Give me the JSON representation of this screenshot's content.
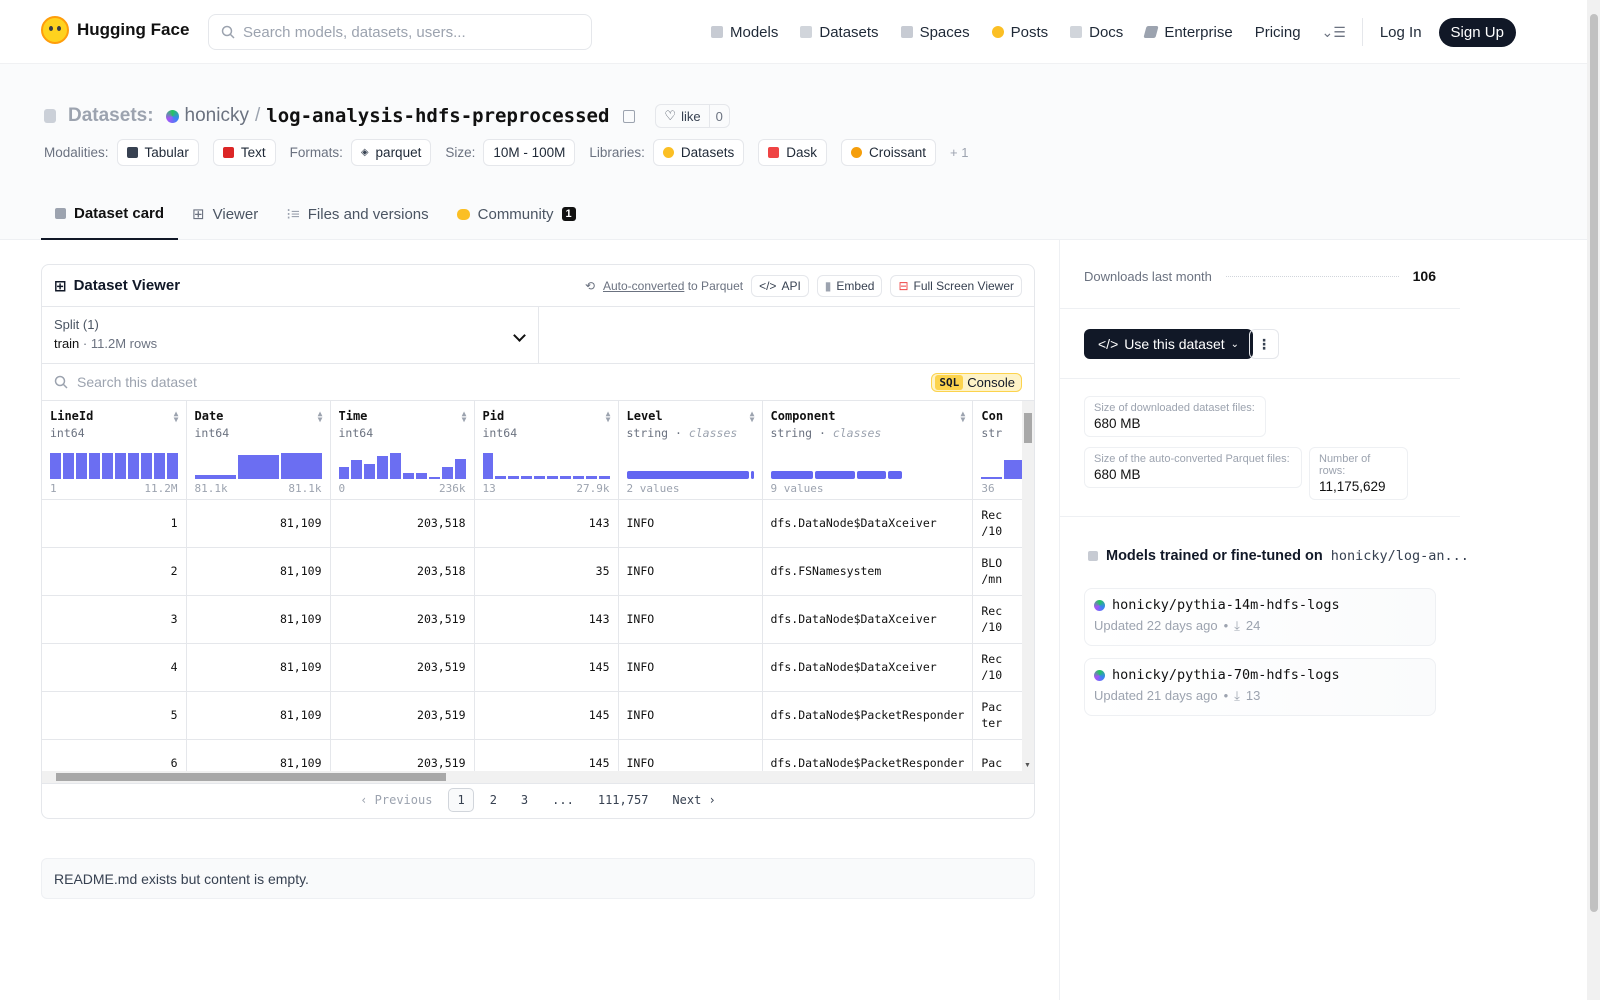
{
  "nav": {
    "brand": "Hugging Face",
    "search_placeholder": "Search models, datasets, users...",
    "links": [
      "Models",
      "Datasets",
      "Spaces",
      "Posts",
      "Docs",
      "Enterprise",
      "Pricing"
    ],
    "login": "Log In",
    "signup": "Sign Up"
  },
  "header": {
    "prefix": "Datasets:",
    "org": "honicky",
    "name": "log-analysis-hdfs-preprocessed",
    "like_label": "like",
    "like_count": "0",
    "modalities_label": "Modalities:",
    "modalities": [
      "Tabular",
      "Text"
    ],
    "formats_label": "Formats:",
    "format": "parquet",
    "size_label": "Size:",
    "size": "10M - 100M",
    "libraries_label": "Libraries:",
    "libraries": [
      "Datasets",
      "Dask",
      "Croissant"
    ],
    "more_libraries": "+ 1",
    "tabs": [
      "Dataset card",
      "Viewer",
      "Files and versions",
      "Community"
    ],
    "community_count": "1"
  },
  "viewer": {
    "title": "Dataset Viewer",
    "auto_converted": "Auto-converted",
    "to_parquet": "to Parquet",
    "api": "API",
    "embed": "Embed",
    "full_screen": "Full Screen Viewer",
    "split_label": "Split (1)",
    "split_name": "train",
    "split_rows": "11.2M rows",
    "search_placeholder": "Search this dataset",
    "sql": "SQL",
    "console": "Console",
    "columns": [
      {
        "name": "LineId",
        "type": "int64",
        "min": "1",
        "max": "11.2M"
      },
      {
        "name": "Date",
        "type": "int64",
        "min": "81.1k",
        "max": "81.1k"
      },
      {
        "name": "Time",
        "type": "int64",
        "min": "0",
        "max": "236k"
      },
      {
        "name": "Pid",
        "type": "int64",
        "min": "13",
        "max": "27.9k"
      },
      {
        "name": "Level",
        "type": "string",
        "sub": "classes",
        "summary": "2 values"
      },
      {
        "name": "Component",
        "type": "string",
        "sub": "classes",
        "summary": "9 values"
      },
      {
        "name": "Con",
        "type": "str",
        "summary": "36"
      }
    ],
    "rows": [
      [
        "1",
        "81,109",
        "203,518",
        "143",
        "INFO",
        "dfs.DataNode$DataXceiver",
        "Rec /10"
      ],
      [
        "2",
        "81,109",
        "203,518",
        "35",
        "INFO",
        "dfs.FSNamesystem",
        "BLO /mn"
      ],
      [
        "3",
        "81,109",
        "203,519",
        "143",
        "INFO",
        "dfs.DataNode$DataXceiver",
        "Rec /10"
      ],
      [
        "4",
        "81,109",
        "203,519",
        "145",
        "INFO",
        "dfs.DataNode$DataXceiver",
        "Rec /10"
      ],
      [
        "5",
        "81,109",
        "203,519",
        "145",
        "INFO",
        "dfs.DataNode$PacketResponder",
        "Pac ter"
      ],
      [
        "6",
        "81,109",
        "203,519",
        "145",
        "INFO",
        "dfs.DataNode$PacketResponder",
        "Pac"
      ]
    ],
    "pager": {
      "prev": "Previous",
      "pages": [
        "1",
        "2",
        "3",
        "...",
        "111,757"
      ],
      "next": "Next"
    }
  },
  "readme": "README.md exists but content is empty.",
  "sidebar": {
    "downloads_label": "Downloads last month",
    "downloads": "106",
    "use_dataset": "Use this dataset",
    "stats": [
      {
        "k": "Size of downloaded dataset files:",
        "v": "680 MB"
      },
      {
        "k": "Size of the auto-converted Parquet files:",
        "v": "680 MB"
      },
      {
        "k": "Number of rows:",
        "v": "11,175,629"
      }
    ],
    "models_title": "Models trained or fine-tuned on",
    "models_ds": "honicky/log-an...",
    "models": [
      {
        "name": "honicky/pythia-14m-hdfs-logs",
        "updated": "Updated 22 days ago",
        "downloads": "24"
      },
      {
        "name": "honicky/pythia-70m-hdfs-logs",
        "updated": "Updated 21 days ago",
        "downloads": "13"
      }
    ]
  }
}
